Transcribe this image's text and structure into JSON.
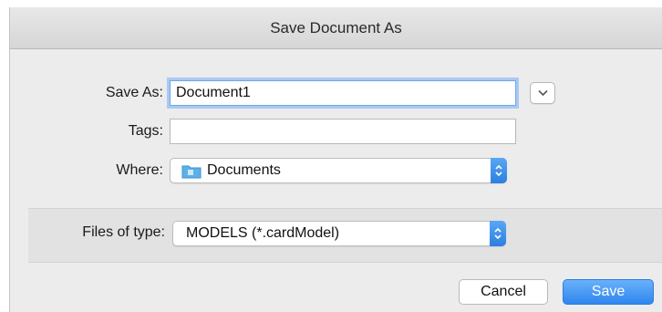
{
  "dialog": {
    "title": "Save Document As"
  },
  "form": {
    "save_as_label": "Save As:",
    "save_as_value": "Document1",
    "tags_label": "Tags:",
    "tags_value": "",
    "where_label": "Where:",
    "where_value": "Documents",
    "where_icon": "folder-icon"
  },
  "file_types": {
    "label": "Files of type:",
    "selected": "MODELS (*.cardModel)"
  },
  "buttons": {
    "cancel": "Cancel",
    "save": "Save"
  },
  "colors": {
    "accent": "#2f86ee",
    "focus_ring": "#a9c9f2",
    "window_bg": "#ececec"
  }
}
